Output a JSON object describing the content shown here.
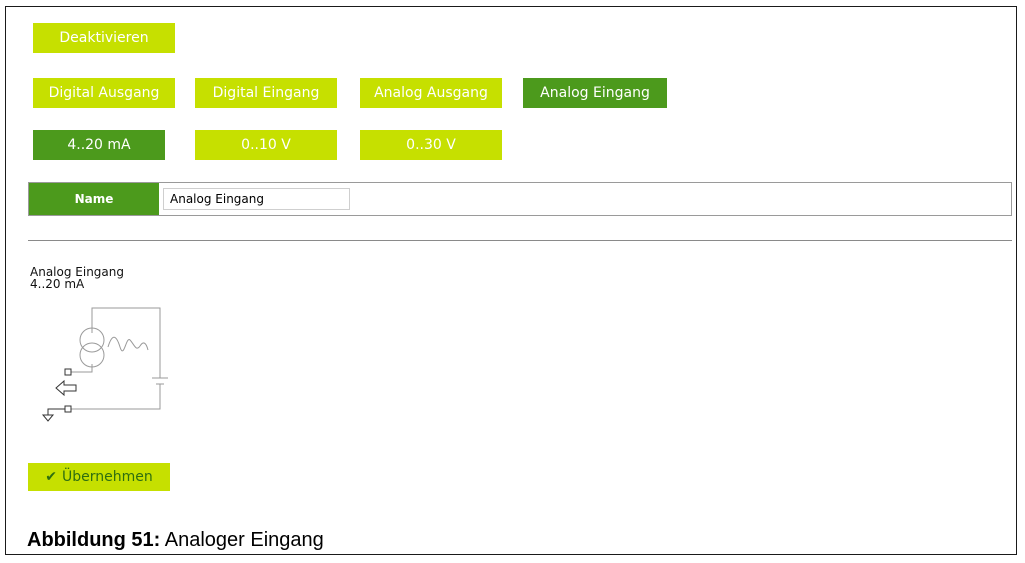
{
  "toolbar": {
    "deactivate_label": "Deaktivieren"
  },
  "modes": [
    {
      "label": "Digital Ausgang",
      "selected": false
    },
    {
      "label": "Digital Eingang",
      "selected": false
    },
    {
      "label": "Analog Ausgang",
      "selected": false
    },
    {
      "label": "Analog Eingang",
      "selected": true
    }
  ],
  "ranges": [
    {
      "label": "4..20 mA",
      "selected": true
    },
    {
      "label": "0..10 V",
      "selected": false
    },
    {
      "label": "0..30 V",
      "selected": false
    }
  ],
  "name_field": {
    "label": "Name",
    "value": "Analog Eingang"
  },
  "preview": {
    "title": "Analog Eingang",
    "subtitle": "4..20 mA",
    "icons": [
      "current-source-icon",
      "input-arrow-icon",
      "ground-icon",
      "battery-icon"
    ]
  },
  "apply": {
    "check": "✔",
    "label": "Übernehmen"
  },
  "figure": {
    "number": "Abbildung 51:",
    "title": "Analoger Eingang"
  },
  "colors": {
    "light_green": "#c6e000",
    "dark_green": "#4c9a1c"
  }
}
